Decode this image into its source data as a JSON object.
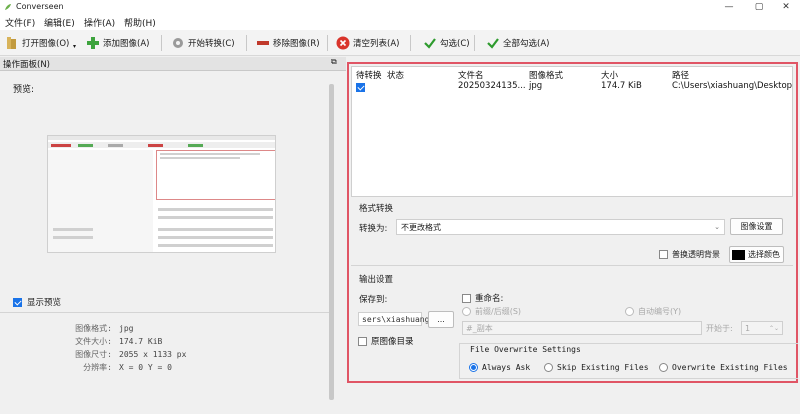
{
  "window": {
    "title": "Converseen",
    "controls": [
      "—",
      "▢",
      "✕"
    ]
  },
  "menu": [
    "文件(F)",
    "编辑(E)",
    "操作(A)",
    "帮助(H)"
  ],
  "toolbar": {
    "open": "打开图像(O)",
    "add": "添加图像(A)",
    "convert": "开始转换(C)",
    "remove": "移除图像(R)",
    "clear": "清空列表(A)",
    "check": "勾选(C)",
    "check_all": "全部勾选(A)"
  },
  "left": {
    "panel_title": "操作面板(N)",
    "preview_label": "预览:",
    "show_preview": "显示预览",
    "info": [
      {
        "label": "图像格式:",
        "value": "jpg"
      },
      {
        "label": "文件大小:",
        "value": "174.7 KiB"
      },
      {
        "label": "图像尺寸:",
        "value": "2055 x 1133 px"
      },
      {
        "label": "分辨率:",
        "value": "X = 0 Y = 0"
      }
    ]
  },
  "filelist": {
    "headers": [
      "待转换",
      "状态",
      "文件名",
      "图像格式",
      "大小",
      "路径"
    ],
    "rows": [
      {
        "checked": true,
        "status": "",
        "filename": "20250324135...",
        "format": "jpg",
        "size": "174.7 KiB",
        "path": "C:\\Users\\xiashuang\\Desktop"
      }
    ]
  },
  "format": {
    "section": "格式转换",
    "convert_to_label": "转换为:",
    "convert_to_value": "不更改格式",
    "image_settings": "图像设置",
    "replace_transparent": "普换透明背景",
    "select_color": "选择颜色",
    "color": "#000000"
  },
  "output": {
    "section": "输出设置",
    "save_to_label": "保存到:",
    "save_to_value": "sers\\xiashuang",
    "browse": "...",
    "source_dir": "原图像目录",
    "rename_label": "重命名:",
    "prefix_suffix": "前缀/后缀(S)",
    "auto_number": "自动编号(Y)",
    "rename_pattern": "#_副本",
    "start_from_label": "开始于:",
    "start_from_value": "1"
  },
  "overwrite": {
    "title": "File Overwrite Settings",
    "options": [
      "Always Ask",
      "Skip Existing Files",
      "Overwrite Existing Files"
    ],
    "selected": "Always Ask"
  },
  "colors": {
    "accent": "#1a73e8",
    "highlight_border": "#e05565"
  }
}
